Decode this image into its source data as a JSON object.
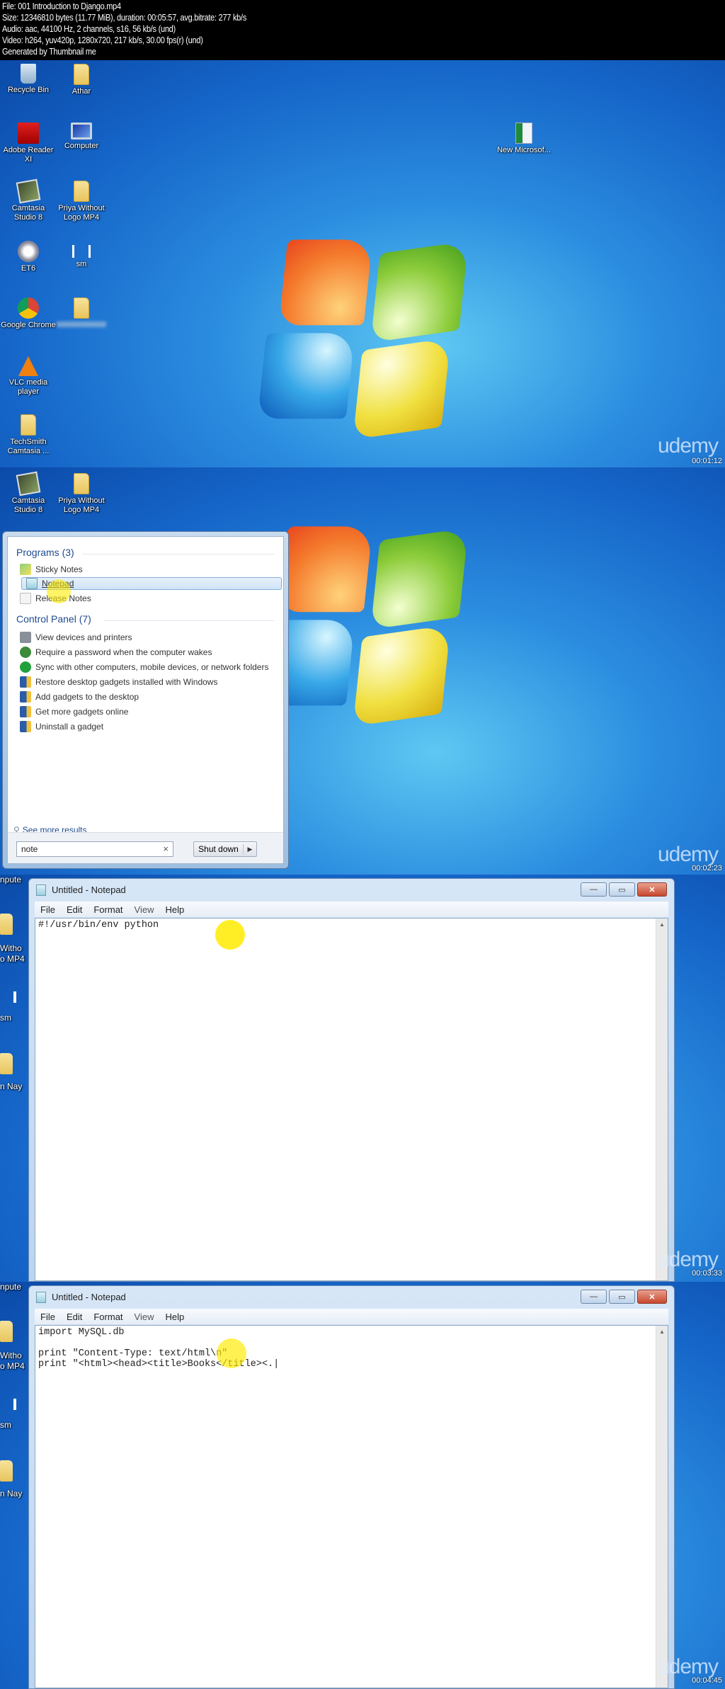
{
  "header": {
    "lines": [
      "File: 001 Introduction to Django.mp4",
      "Size: 12346810 bytes (11.77 MiB), duration: 00:05:57, avg.bitrate: 277 kb/s",
      "Audio: aac, 44100 Hz, 2 channels, s16, 56 kb/s (und)",
      "Video: h264, yuv420p, 1280x720, 217 kb/s, 30.00 fps(r) (und)",
      "Generated by Thumbnail me"
    ]
  },
  "watermark": "udemy",
  "frames": [
    {
      "timestamp": "00:01:12",
      "desktop_icons": [
        {
          "label": "Recycle Bin",
          "icon": "recycle-bin-icon"
        },
        {
          "label": "Athar",
          "icon": "folder-icon"
        },
        {
          "label": "Adobe Reader XI",
          "icon": "adobe-reader-icon"
        },
        {
          "label": "Computer",
          "icon": "computer-icon"
        },
        {
          "label": "Camtasia Studio 8",
          "icon": "camtasia-icon"
        },
        {
          "label": "Priya Without Logo MP4",
          "icon": "folder-icon"
        },
        {
          "label": "ET6",
          "icon": "et6-icon"
        },
        {
          "label": "sm",
          "icon": "sm-icon"
        },
        {
          "label": "Google Chrome",
          "icon": "chrome-icon"
        },
        {
          "label": "",
          "icon": "folder-icon"
        },
        {
          "label": "VLC media player",
          "icon": "vlc-icon"
        },
        {
          "label": "TechSmith Camtasia ...",
          "icon": "folder-icon"
        },
        {
          "label": "New Microsof...",
          "icon": "excel-file-icon"
        }
      ]
    },
    {
      "timestamp": "00:02:23",
      "desktop_icons": [
        {
          "label": "Camtasia Studio 8",
          "icon": "camtasia-icon"
        },
        {
          "label": "Priya Without Logo MP4",
          "icon": "folder-icon"
        }
      ],
      "start_menu": {
        "programs_heading": "Programs (3)",
        "programs": [
          "Sticky Notes",
          "Notepad",
          "Release Notes"
        ],
        "selected_program": "Notepad",
        "control_panel_heading": "Control Panel (7)",
        "control_panel": [
          "View devices and printers",
          "Require a password when the computer wakes",
          "Sync with other computers, mobile devices, or network folders",
          "Restore desktop gadgets installed with Windows",
          "Add gadgets to the desktop",
          "Get more gadgets online",
          "Uninstall a gadget"
        ],
        "see_more": "See more results",
        "search_value": "note",
        "search_clear": "×",
        "shutdown_label": "Shut down",
        "shutdown_arrow": "▶"
      }
    },
    {
      "timestamp": "00:03:33",
      "notepad": {
        "title": "Untitled - Notepad",
        "menu": [
          "File",
          "Edit",
          "Format",
          "View",
          "Help"
        ],
        "content": "#!/usr/bin/env python"
      },
      "strip_labels": [
        "npute",
        "Witho",
        "o MP4",
        "sm",
        "n Nay"
      ]
    },
    {
      "timestamp": "00:04:45",
      "notepad": {
        "title": "Untitled - Notepad",
        "menu": [
          "File",
          "Edit",
          "Format",
          "View",
          "Help"
        ],
        "content": "import MySQL.db\n\nprint \"Content-Type: text/html\\n\"\nprint \"<html><head><title>Books</title><.|"
      },
      "strip_labels": [
        "npute",
        "Witho",
        "o MP4",
        "sm",
        "n Nay"
      ]
    }
  ],
  "window_buttons": {
    "minimize": "—",
    "maximize": "▭",
    "close": "✕"
  }
}
